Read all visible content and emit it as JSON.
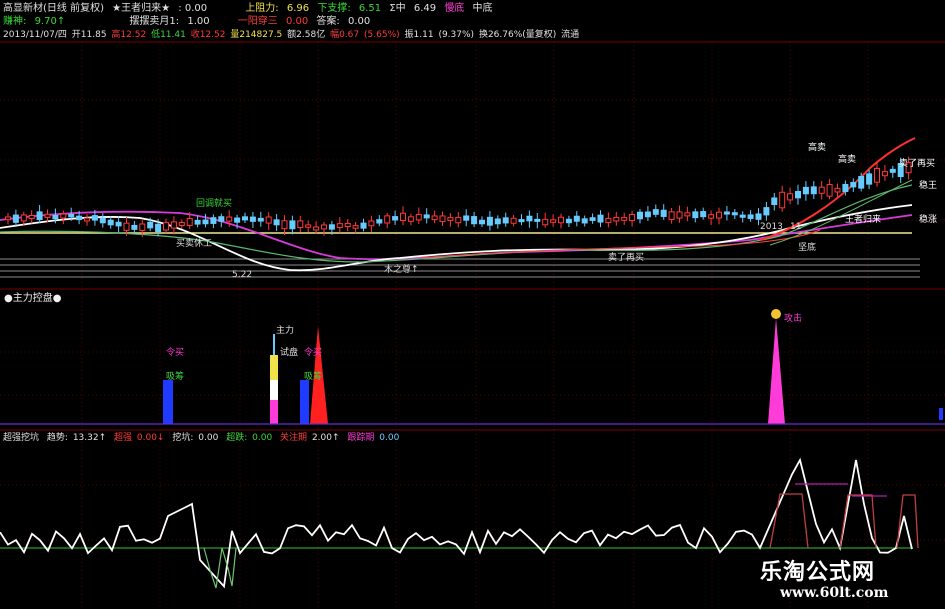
{
  "info_bar_1": {
    "stock": "高显新材(日线 前复权)",
    "formula": "★王者归来★",
    "colon_value": ": 0.00",
    "resist_label": "上阻力:",
    "resist_value": "6.96",
    "support_label": "下支撑:",
    "support_value": "6.51",
    "i_mid": "Σ中",
    "i_mid_value": "6.49",
    "slow": "慢底",
    "mid_bottom": "中底"
  },
  "info_bar_2": {
    "mammon": "赚神:",
    "mammon_value": "9.70↑",
    "month": "摆摆卖月1:",
    "month_value": "1.00",
    "yiyang": "一阳穿三",
    "yiyang_value": "0.00",
    "answer": "答案:",
    "answer_value": "0.00"
  },
  "quote_bar": {
    "date": "2013/11/07/四",
    "open": "开11.85",
    "high": "高12.52",
    "low": "低11.41",
    "close": "收12.52",
    "volume": "量214827.5",
    "amount": "额2.58亿",
    "change": "幅0.67",
    "change_pct": "(5.65%)",
    "swing": "振1.11",
    "swing_pct": "(9.37%)",
    "turnover": "换26.76%(量复权)",
    "float": "流通"
  },
  "main_labels": {
    "pullback_buy": "回调就买",
    "gao_mai": "高卖",
    "gao_mai2": "高卖",
    "buy_then_sell": "卖了再买",
    "king_return": "王者归来",
    "stable_king": "稳王",
    "stable_up": "稳涨",
    "jian_di": "坚底",
    "sell_then_buy": "卖了再买",
    "wood_buy": "木之尊↑",
    "year_label": "2013",
    "month_label": "11",
    "price_min": "5.22",
    "buy_rest": "买卖休工"
  },
  "panel2": {
    "title": "●主力控盘●",
    "attack": "攻击",
    "zhuli": "主力",
    "shipan": "试盘",
    "ling_mai": "令买",
    "ling_mai2": "令买",
    "xi_mai": "吸筹",
    "xi_mai2": "吸筹"
  },
  "panel3": {
    "title": "超强挖坑",
    "trend_label": "趋势:",
    "trend_value": "13.32↑",
    "super_label": "超强",
    "super_value": "0.00↓",
    "dig_label": "挖坑:",
    "dig_value": "0.00",
    "cross_label": "超跌:",
    "cross_value": "0.00",
    "watch_label": "关注期",
    "watch_value": "2.00↑",
    "track_label": "跟踪期",
    "track_value": "0.00"
  },
  "watermark": {
    "name": "乐淘公式网",
    "url": "www.60lt.com"
  },
  "colors": {
    "background": "#000000",
    "up": "#ff3a3a",
    "down": "#39d839",
    "yellow": "#f1e14a",
    "magenta": "#ff3bd8",
    "blue": "#1f3bff"
  }
}
